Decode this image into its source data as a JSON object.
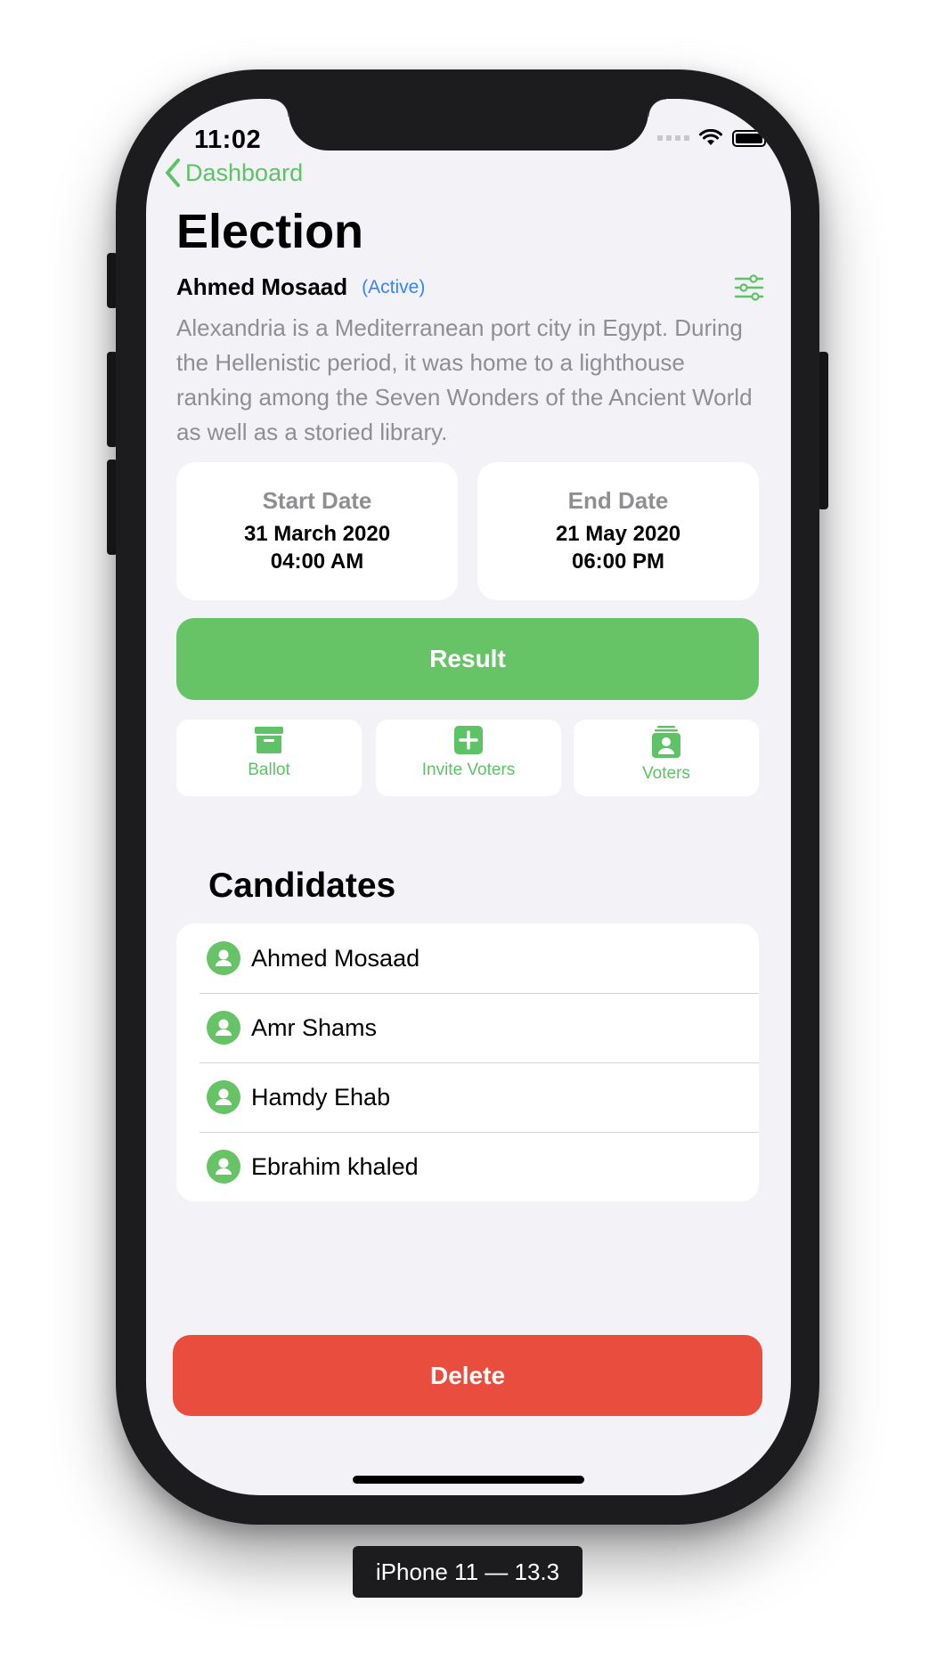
{
  "status_bar": {
    "time": "11:02"
  },
  "nav": {
    "back_label": "Dashboard"
  },
  "page": {
    "title": "Election"
  },
  "election": {
    "owner": "Ahmed Mosaad",
    "status": "(Active)",
    "description": "Alexandria is a Mediterranean port city in Egypt. During the Hellenistic period, it was home to a lighthouse ranking among the Seven Wonders of the Ancient World as well as a storied library."
  },
  "dates": {
    "start": {
      "label": "Start Date",
      "date": "31 March 2020",
      "time": "04:00 AM"
    },
    "end": {
      "label": "End Date",
      "date": "21 May 2020",
      "time": "06:00 PM"
    }
  },
  "buttons": {
    "result": "Result",
    "delete": "Delete"
  },
  "actions": [
    {
      "label": "Ballot",
      "icon": "archive-box-icon"
    },
    {
      "label": "Invite Voters",
      "icon": "plus-square-icon"
    },
    {
      "label": "Voters",
      "icon": "voters-stack-icon"
    }
  ],
  "candidates": {
    "title": "Candidates",
    "items": [
      "Ahmed Mosaad",
      "Amr Shams",
      "Hamdy Ehab",
      "Ebrahim khaled"
    ]
  },
  "device_label": "iPhone 11 — 13.3",
  "colors": {
    "accent": "#66c466",
    "danger": "#e84d3d",
    "status_link": "#3a82f7",
    "background": "#f2f2f7"
  }
}
